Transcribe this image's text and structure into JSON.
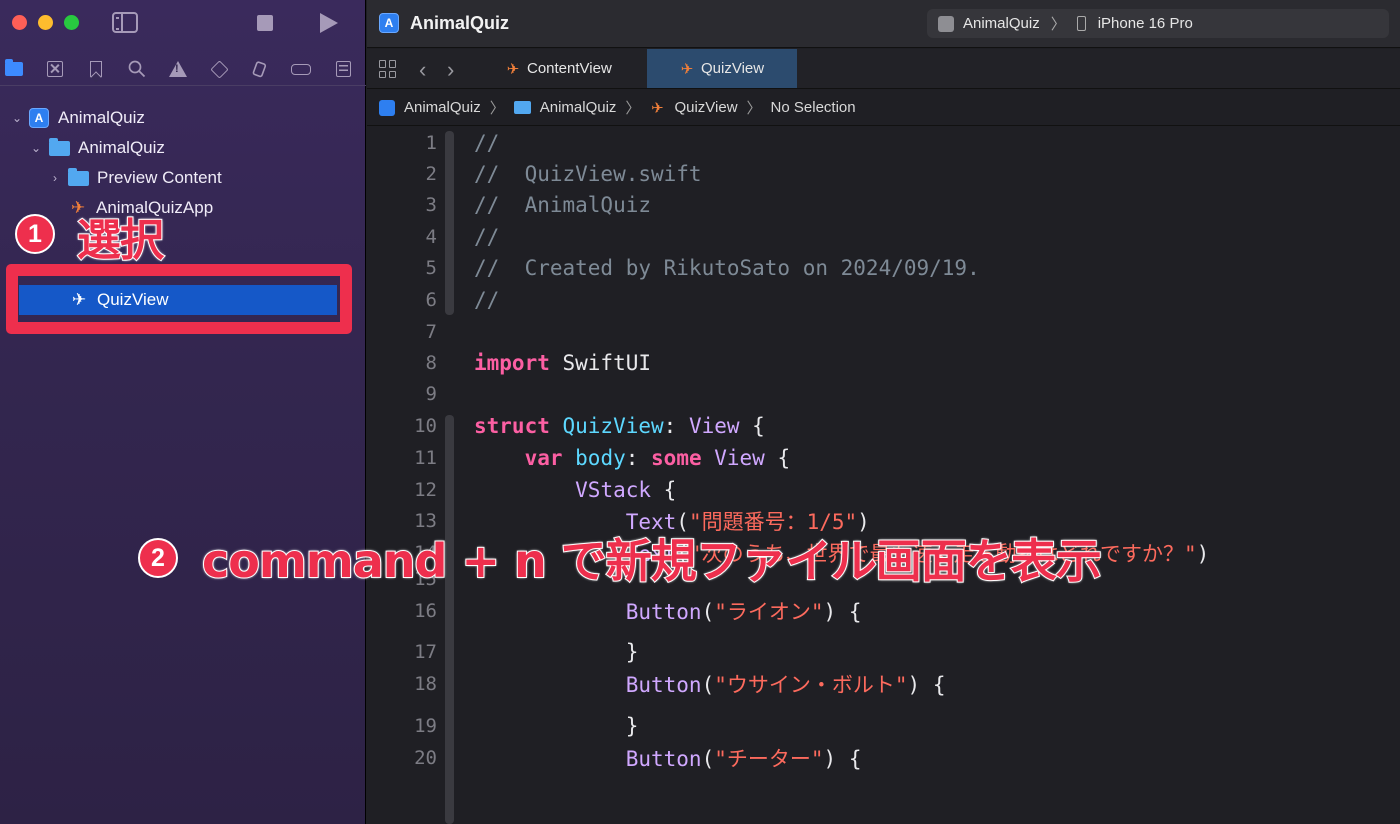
{
  "window": {
    "title": "AnimalQuiz"
  },
  "scheme": {
    "target": "AnimalQuiz",
    "device": "iPhone 16 Pro"
  },
  "navigator": {
    "tree": [
      {
        "label": "AnimalQuiz"
      },
      {
        "label": "AnimalQuiz"
      },
      {
        "label": "Preview Content"
      },
      {
        "label": "AnimalQuizApp"
      },
      {
        "label": "QuizView"
      }
    ]
  },
  "tabs": [
    {
      "label": "ContentView"
    },
    {
      "label": "QuizView"
    }
  ],
  "jump_bar": [
    {
      "label": "AnimalQuiz"
    },
    {
      "label": "AnimalQuiz"
    },
    {
      "label": "QuizView"
    },
    {
      "label": "No Selection"
    }
  ],
  "annotations": {
    "step1": {
      "number": "1",
      "text": "選択"
    },
    "step2": {
      "number": "2",
      "text": "command + n で新規ファイル画面を表示"
    }
  },
  "code": {
    "lines": [
      {
        "num": "1",
        "text": "//"
      },
      {
        "num": "2",
        "text": "//  QuizView.swift"
      },
      {
        "num": "3",
        "text": "//  AnimalQuiz"
      },
      {
        "num": "4",
        "text": "//"
      },
      {
        "num": "5",
        "text": "//  Created by RikutoSato on 2024/09/19."
      },
      {
        "num": "6",
        "text": "//"
      },
      {
        "num": "7",
        "text": ""
      },
      {
        "num": "8",
        "kw": "import",
        "rest": " SwiftUI"
      },
      {
        "num": "9",
        "text": ""
      },
      {
        "num": "10",
        "kw": "struct",
        "name": " QuizView",
        "rest": ": ",
        "type": "View",
        "tail": " {"
      },
      {
        "num": "11",
        "indent": "    ",
        "kw": "var",
        "name": " body",
        "rest": ": ",
        "kw2": "some",
        "type": " View",
        "tail": " {"
      },
      {
        "num": "12",
        "indent": "        ",
        "type": "VStack",
        "tail": " {"
      },
      {
        "num": "13",
        "indent": "            ",
        "type": "Text",
        "tail": "(",
        "str": "\"問題番号：1/5\"",
        "end": ")"
      },
      {
        "num": "14",
        "indent": "            ",
        "type": "Text",
        "tail": "(",
        "str": "\"次のうち、世界で最も速く走る動物はどれですか？\"",
        "end": ")"
      },
      {
        "num": "15",
        "text": ""
      },
      {
        "num": "16",
        "indent": "            ",
        "type": "Button",
        "tail": "(",
        "str": "\"ライオン\"",
        "end": ") {"
      },
      {
        "num": "17",
        "indent": "            ",
        "plain": "}"
      },
      {
        "num": "18",
        "indent": "            ",
        "type": "Button",
        "tail": "(",
        "str": "\"ウサイン・ボルト\"",
        "end": ") {"
      },
      {
        "num": "19",
        "indent": "            ",
        "plain": "}"
      },
      {
        "num": "20",
        "indent": "            ",
        "type": "Button",
        "tail": "(",
        "str": "\"チーター\"",
        "end": ") {"
      }
    ]
  },
  "colors": {
    "accent": "#1558c8",
    "annotation": "#ee2f4d",
    "keyword": "#fc5fa3",
    "type": "#d0a8ff",
    "string": "#fc6a5d",
    "comment": "#7e8a96"
  }
}
